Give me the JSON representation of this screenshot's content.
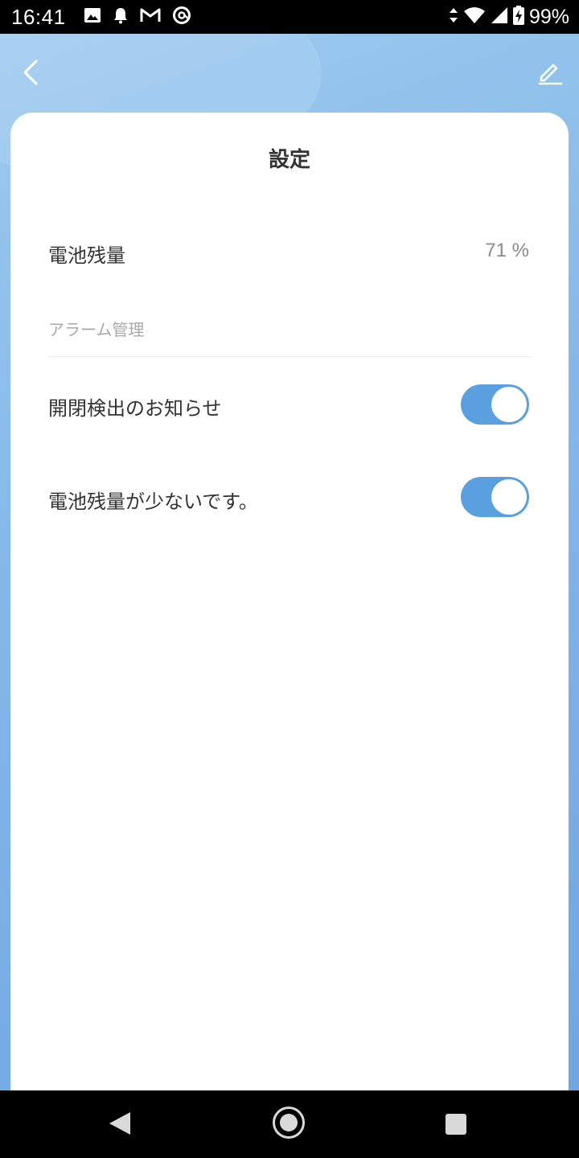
{
  "status_bar": {
    "time": "16:41",
    "battery": "99%",
    "left_icons": [
      "image-icon",
      "notification-bell-icon",
      "gmail-icon",
      "at-sign-icon"
    ],
    "right_icons": [
      "data-arrows-icon",
      "wifi-icon",
      "cell-signal-icon",
      "battery-charging-icon"
    ]
  },
  "header": {
    "back_icon": "chevron-left-icon",
    "edit_icon": "pencil-icon"
  },
  "settings": {
    "title": "設定",
    "battery": {
      "label": "電池残量",
      "value": "71 %"
    },
    "alarm_section": "アラーム管理",
    "toggles": [
      {
        "label": "開閉検出のお知らせ",
        "on": true
      },
      {
        "label": "電池残量が少ないです。",
        "on": true
      }
    ]
  },
  "nav_bar": {
    "back_icon": "nav-back-icon",
    "home_icon": "nav-home-icon",
    "recents_icon": "nav-recents-icon"
  },
  "colors": {
    "header_gradient_start": "#9ccaef",
    "header_gradient_end": "#6fa6e2",
    "toggle_on": "#5aa0e0",
    "card_bg": "#ffffff"
  }
}
